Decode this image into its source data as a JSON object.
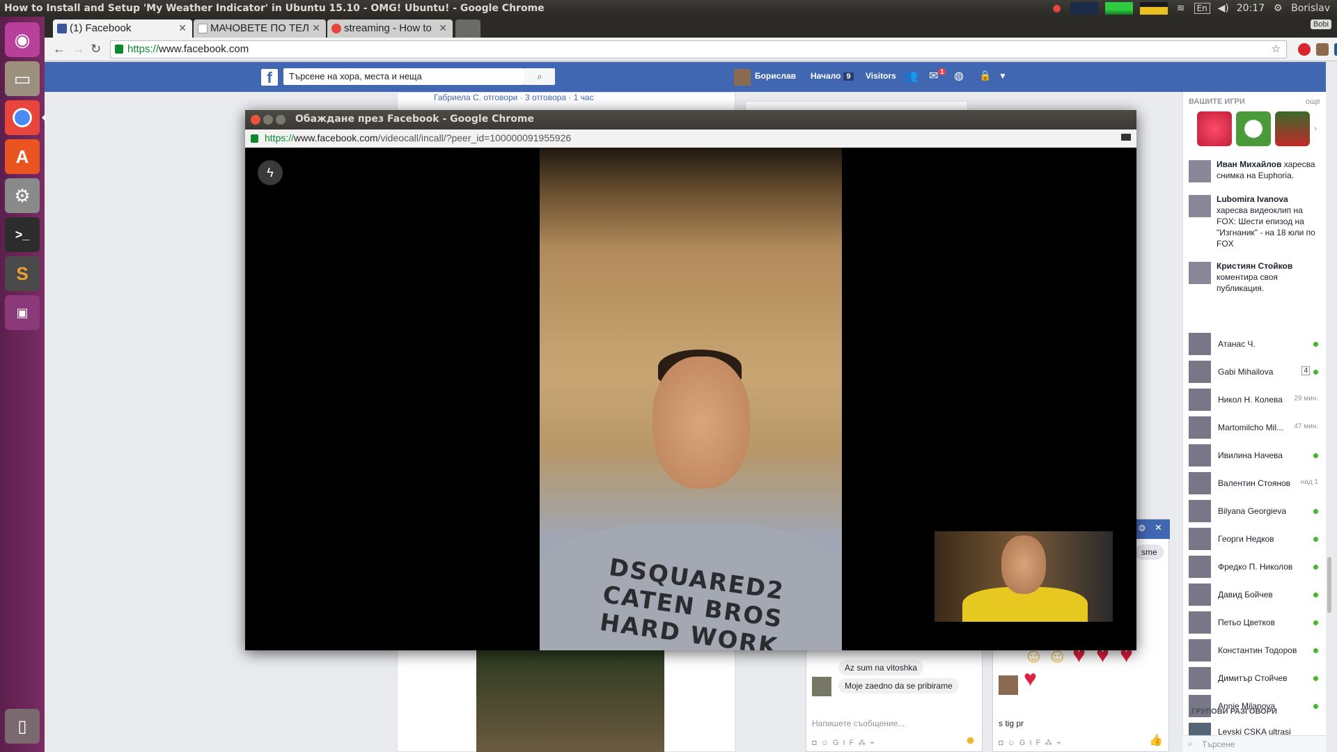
{
  "os_panel": {
    "window_title": "How to Install and Setup 'My Weather Indicator' in Ubuntu 15.10 - OMG! Ubuntu! - Google Chrome",
    "language": "En",
    "time": "20:17",
    "user": "Borislav"
  },
  "launcher": {
    "items": [
      {
        "name": "ubuntu-dash-icon",
        "glyph": "◉"
      },
      {
        "name": "files-icon",
        "glyph": "▭"
      },
      {
        "name": "chrome-icon",
        "glyph": "●"
      },
      {
        "name": "software-center-icon",
        "glyph": "A"
      },
      {
        "name": "system-settings-icon",
        "glyph": "⚙"
      },
      {
        "name": "terminal-icon",
        "glyph": ">_"
      },
      {
        "name": "sublime-text-icon",
        "glyph": "S"
      },
      {
        "name": "workspace-switcher-icon",
        "glyph": "▣"
      },
      {
        "name": "trash-icon",
        "glyph": "🗑"
      }
    ]
  },
  "browser": {
    "tabs": [
      {
        "label": "(1) Facebook",
        "active": true
      },
      {
        "label": "МАЧОВЕТЕ ПО ТЕЛ",
        "active": false
      },
      {
        "label": "streaming - How to",
        "active": false
      }
    ],
    "profile_label": "Bobi",
    "url_scheme": "https://",
    "url_host": "www.facebook.com"
  },
  "facebook": {
    "search_placeholder": "Търсене на хора, места и неща",
    "profile_name": "Борислав",
    "home_label": "Начало",
    "home_count": "9",
    "visitors_label": "Visitors",
    "messages_badge": "1",
    "feed_reply_text": "Габриела С. отговори · 3 отговора · 1 час"
  },
  "right_column": {
    "games_header": "ВАШИТЕ ИГРИ",
    "games_more": "още",
    "ticker": [
      {
        "name": "Иван Михайлов",
        "text": " харесва снимка на Euphoria."
      },
      {
        "name": "Lubomira Ivanova",
        "text": " харесва видеоклип на FOX: Шести епизод на \"Изгнаник\" - на 18 юли по FOX"
      },
      {
        "name": "Кристиян Стойков",
        "text": " коментира своя публикация."
      }
    ],
    "contacts": [
      {
        "name": "Атанас Ч.",
        "status": "",
        "online": true
      },
      {
        "name": "Gabi Mihailova",
        "status": "",
        "online": true,
        "count": "4"
      },
      {
        "name": "Никол Н. Колева",
        "status": "29 мин.",
        "online": false
      },
      {
        "name": "Martomilcho Mil...",
        "status": "47 мин.",
        "online": false
      },
      {
        "name": "Ивилина Начева",
        "status": "",
        "online": true
      },
      {
        "name": "Валентин Стоянов",
        "status": "над 1",
        "online": false
      },
      {
        "name": "Bilyana Georgieva",
        "status": "",
        "online": true
      },
      {
        "name": "Георги Недков",
        "status": "",
        "online": true
      },
      {
        "name": "Фредко П. Николов",
        "status": "",
        "online": true
      },
      {
        "name": "Давид Бойчев",
        "status": "",
        "online": true
      },
      {
        "name": "Петьо Цветков",
        "status": "",
        "online": true
      },
      {
        "name": "Константин Тодоров",
        "status": "",
        "online": true
      },
      {
        "name": "Димитър Стойчев",
        "status": "",
        "online": true
      },
      {
        "name": "Annie Milanova",
        "status": "",
        "online": true
      }
    ],
    "group_header": "ГРУПОВИ РАЗГОВОРИ",
    "group_name": "Levski CSKA ultrasi",
    "chat_search_placeholder": "Търсене"
  },
  "chat1": {
    "messages": [
      "Az sum na vitoshka",
      "Moje zaedno da se pribirame"
    ],
    "input_placeholder": "Напишете съобщение...",
    "tools": "GIF"
  },
  "chat2": {
    "input_text": "s tig pr",
    "partial_message": "sme",
    "tools": "GIF"
  },
  "popup": {
    "title": "Обаждане през Facebook - Google Chrome",
    "url_scheme": "https://",
    "url_host": "www.facebook.com",
    "url_path": "/videocall/incall/?peer_id=100000091955926",
    "shirt_text": "DSQUARED2 CATEN BROS HARD WORK"
  }
}
